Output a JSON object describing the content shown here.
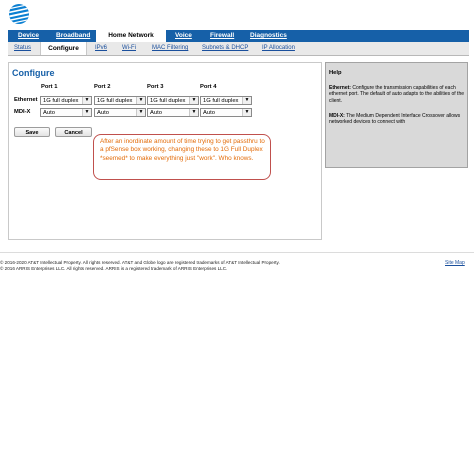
{
  "brand": {
    "logo_icon": "att-globe-logo-icon",
    "color": "#1660a8"
  },
  "primary_nav": [
    {
      "label": "Device"
    },
    {
      "label": "Broadband"
    },
    {
      "label": "Home Network",
      "active": true
    },
    {
      "label": "Voice"
    },
    {
      "label": "Firewall"
    },
    {
      "label": "Diagnostics"
    }
  ],
  "secondary_nav": [
    {
      "label": "Status"
    },
    {
      "label": "Configure",
      "active": true
    },
    {
      "label": "IPv6"
    },
    {
      "label": "Wi-Fi"
    },
    {
      "label": "MAC Filtering"
    },
    {
      "label": "Subnets & DHCP"
    },
    {
      "label": "IP Allocation"
    }
  ],
  "page": {
    "title": "Configure"
  },
  "form": {
    "ports": [
      "Port 1",
      "Port 2",
      "Port 3",
      "Port 4"
    ],
    "rows": [
      {
        "label": "Ethernet",
        "values": [
          "1G full duplex",
          "1G full duplex",
          "1G full duplex",
          "1G full duplex"
        ]
      },
      {
        "label": "MDI-X",
        "values": [
          "Auto",
          "Auto",
          "Auto",
          "Auto"
        ]
      }
    ],
    "save_label": "Save",
    "cancel_label": "Cancel"
  },
  "annotation": {
    "text": "After an inordinate amount of time trying to get passthru to a pfSense box working, changing these to 1G Full Duplex *seemed* to make everything just \"work\".  Who knows.",
    "color": "#e36c0a",
    "border_color": "#c0504d"
  },
  "help": {
    "title": "Help",
    "ethernet_term": "Ethernet:",
    "ethernet_text": "Configure the transmission capabilities of each ethernet port. The default of auto adapts to the abilities of the client.",
    "mdix_term": "MDI-X:",
    "mdix_text": "The Medium Dependent Interface Crossover allows networked devices to connect with"
  },
  "footer": {
    "line1": "© 2016-2020 AT&T Intellectual Property. All rights reserved. AT&T and Globe logo are registered trademarks of AT&T Intellectual Property.",
    "line2": "© 2016 ARRIS Enterprises LLC. All rights reserved. ARRIS is a registered trademark of ARRIS Enterprises LLC.",
    "site_map": "Site Map"
  }
}
